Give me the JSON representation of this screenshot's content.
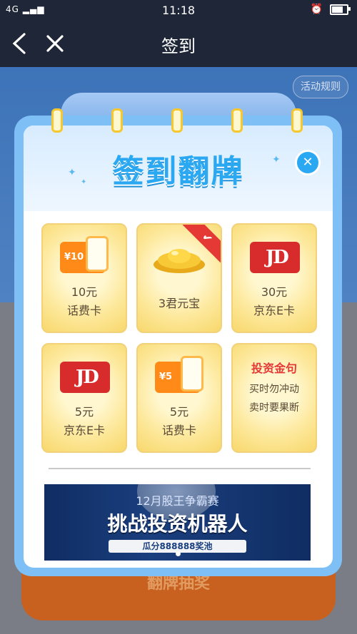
{
  "status_bar": {
    "signal": "4G",
    "time": "11:18"
  },
  "nav": {
    "title": "签到"
  },
  "background": {
    "title": "签到翻牌",
    "rules_button": "活动规则",
    "bottom_button": "翻牌抽奖"
  },
  "modal": {
    "title": "签到翻牌",
    "cards": [
      {
        "icon": "phone-card-icon",
        "badge": "¥10",
        "line1": "10元",
        "line2": "话费卡"
      },
      {
        "icon": "gold-ingot-icon",
        "line1": "3君元宝",
        "checked": true
      },
      {
        "icon": "jd-card-icon",
        "badge": "JD",
        "line1": "30元",
        "line2": "京东E卡"
      },
      {
        "icon": "jd-card-icon",
        "badge": "JD",
        "line1": "5元",
        "line2": "京东E卡"
      },
      {
        "icon": "phone-card-icon",
        "badge": "¥5",
        "line1": "5元",
        "line2": "话费卡"
      },
      {
        "icon": "quote-icon",
        "title": "投资金句",
        "line1": "买时勿冲动",
        "line2": "卖时要果断"
      }
    ],
    "banner": {
      "subtitle": "12月股王争霸赛",
      "headline": "挑战投资机器人",
      "pool": "瓜分888888奖池"
    }
  },
  "colors": {
    "accent_blue": "#2aa8f2",
    "navbar": "#1f2638",
    "gold": "#f8d86c",
    "red": "#d82c2c",
    "orange": "#ff8a18"
  }
}
